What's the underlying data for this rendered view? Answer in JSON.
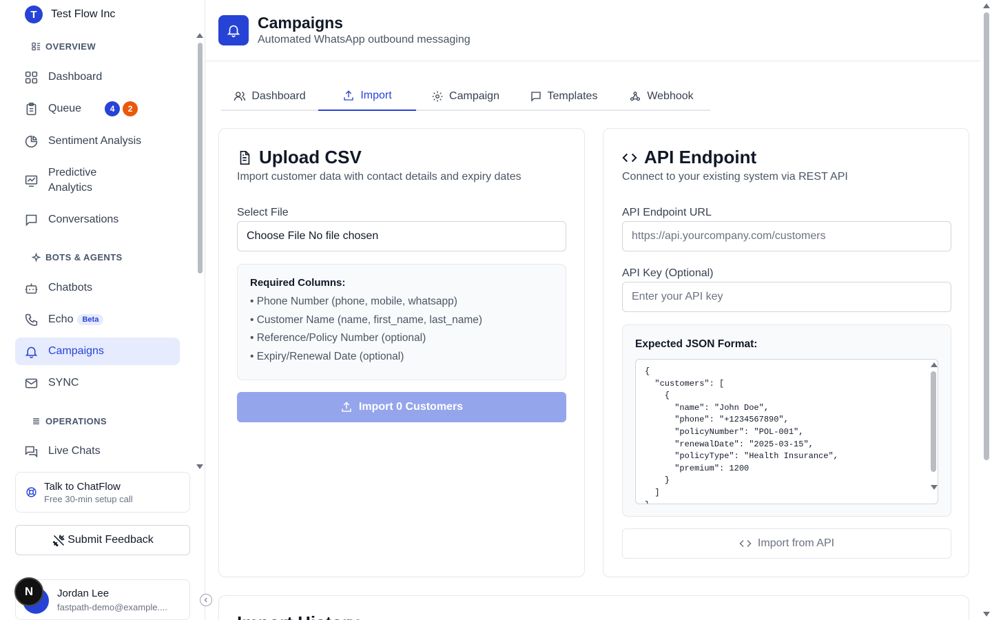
{
  "org": {
    "initial": "T",
    "name": "Test Flow Inc"
  },
  "sidebar": {
    "sections": {
      "overview": "OVERVIEW",
      "bots": "BOTS & AGENTS",
      "operations": "OPERATIONS"
    },
    "items": {
      "dashboard": "Dashboard",
      "queue": "Queue",
      "queue_badge_blue": "4",
      "queue_badge_orange": "2",
      "sentiment": "Sentiment Analysis",
      "predictive_1": "Predictive",
      "predictive_2": "Analytics",
      "conversations": "Conversations",
      "chatbots": "Chatbots",
      "echo": "Echo",
      "echo_badge": "Beta",
      "campaigns": "Campaigns",
      "sync": "SYNC",
      "live_chats": "Live Chats"
    },
    "talk": {
      "title": "Talk to ChatFlow",
      "subtitle": "Free 30-min setup call"
    },
    "feedback": "Submit Feedback",
    "user": {
      "name": "Jordan Lee",
      "email": "fastpath-demo@example...."
    },
    "next_badge": "N"
  },
  "header": {
    "title": "Campaigns",
    "subtitle": "Automated WhatsApp outbound messaging"
  },
  "tabs": [
    "Dashboard",
    "Import",
    "Campaign",
    "Templates",
    "Webhook"
  ],
  "upload": {
    "title": "Upload CSV",
    "subtitle": "Import customer data with contact details and expiry dates",
    "select_label": "Select File",
    "file_button": "Choose File",
    "file_status": "No file chosen",
    "required_title": "Required Columns:",
    "required": [
      "• Phone Number (phone, mobile, whatsapp)",
      "• Customer Name (name, first_name, last_name)",
      "• Reference/Policy Number (optional)",
      "• Expiry/Renewal Date (optional)"
    ],
    "import_button": "Import 0 Customers"
  },
  "api": {
    "title": "API Endpoint",
    "subtitle": "Connect to your existing system via REST API",
    "url_label": "API Endpoint URL",
    "url_placeholder": "https://api.yourcompany.com/customers",
    "key_label": "API Key (Optional)",
    "key_placeholder": "Enter your API key",
    "json_title": "Expected JSON Format:",
    "json_sample": "{\n  \"customers\": [\n    {\n      \"name\": \"John Doe\",\n      \"phone\": \"+1234567890\",\n      \"policyNumber\": \"POL-001\",\n      \"renewalDate\": \"2025-03-15\",\n      \"policyType\": \"Health Insurance\",\n      \"premium\": 1200\n    }\n  ]\n}",
    "import_button": "Import from API"
  },
  "history": {
    "title": "Import History"
  }
}
